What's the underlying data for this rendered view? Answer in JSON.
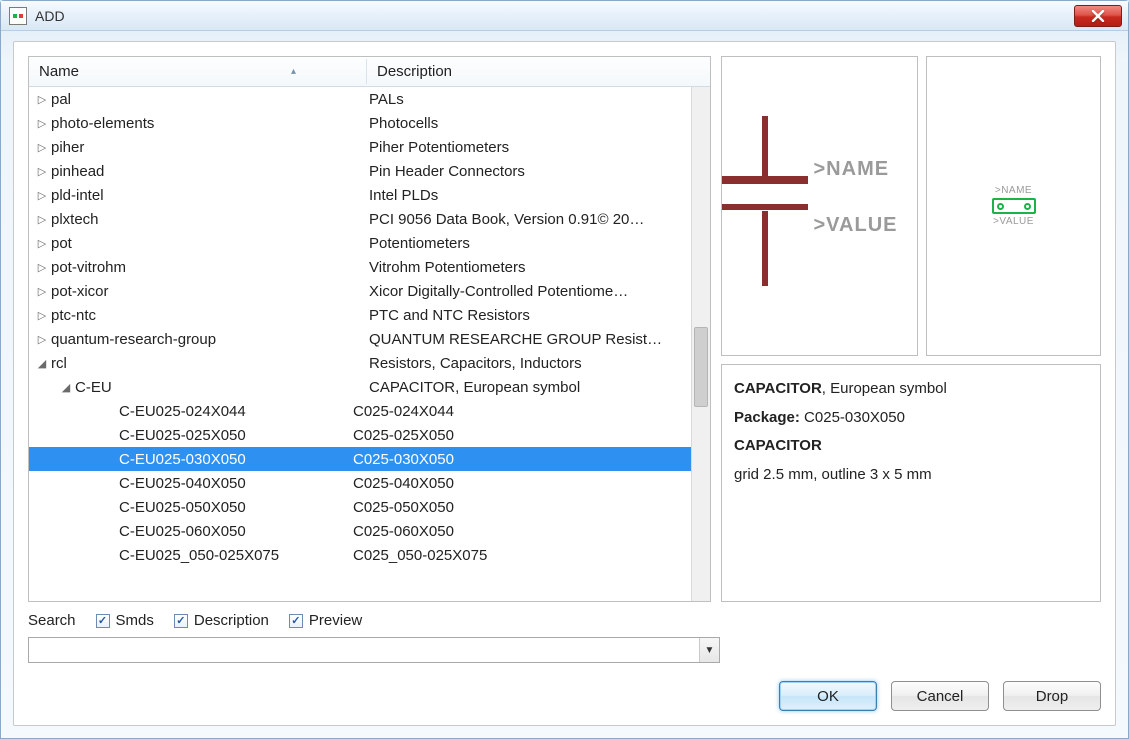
{
  "window": {
    "title": "ADD"
  },
  "columns": {
    "name": "Name",
    "description": "Description"
  },
  "rows": [
    {
      "name": "pal",
      "desc": "PALs",
      "depth": 0,
      "expand": "closed"
    },
    {
      "name": "photo-elements",
      "desc": "Photocells",
      "depth": 0,
      "expand": "closed"
    },
    {
      "name": "piher",
      "desc": "Piher Potentiometers",
      "depth": 0,
      "expand": "closed"
    },
    {
      "name": "pinhead",
      "desc": "Pin Header Connectors",
      "depth": 0,
      "expand": "closed"
    },
    {
      "name": "pld-intel",
      "desc": "Intel PLDs",
      "depth": 0,
      "expand": "closed"
    },
    {
      "name": "plxtech",
      "desc": "PCI 9056 Data Book, Version 0.91© 20…",
      "depth": 0,
      "expand": "closed"
    },
    {
      "name": "pot",
      "desc": "Potentiometers",
      "depth": 0,
      "expand": "closed"
    },
    {
      "name": "pot-vitrohm",
      "desc": "Vitrohm Potentiometers",
      "depth": 0,
      "expand": "closed"
    },
    {
      "name": "pot-xicor",
      "desc": "Xicor Digitally-Controlled Potentiome…",
      "depth": 0,
      "expand": "closed"
    },
    {
      "name": "ptc-ntc",
      "desc": "PTC and NTC Resistors",
      "depth": 0,
      "expand": "closed"
    },
    {
      "name": "quantum-research-group",
      "desc": "QUANTUM RESEARCHE GROUP Resist…",
      "depth": 0,
      "expand": "closed"
    },
    {
      "name": "rcl",
      "desc": "Resistors, Capacitors, Inductors",
      "depth": 0,
      "expand": "open"
    },
    {
      "name": "C-EU",
      "desc": "CAPACITOR, European symbol",
      "depth": 1,
      "expand": "open"
    },
    {
      "name": "C-EU025-024X044",
      "desc": "C025-024X044",
      "depth": 2
    },
    {
      "name": "C-EU025-025X050",
      "desc": "C025-025X050",
      "depth": 2
    },
    {
      "name": "C-EU025-030X050",
      "desc": "C025-030X050",
      "depth": 2,
      "selected": true
    },
    {
      "name": "C-EU025-040X050",
      "desc": "C025-040X050",
      "depth": 2
    },
    {
      "name": "C-EU025-050X050",
      "desc": "C025-050X050",
      "depth": 2
    },
    {
      "name": "C-EU025-060X050",
      "desc": "C025-060X050",
      "depth": 2
    },
    {
      "name": "C-EU025_050-025X075",
      "desc": "C025_050-025X075",
      "depth": 2
    }
  ],
  "preview": {
    "name_placeholder": ">NAME",
    "value_placeholder": ">VALUE",
    "board_name": ">NAME",
    "board_value": ">VALUE"
  },
  "info": {
    "type_bold": "CAPACITOR",
    "type_rest": ", European symbol",
    "package_label": "Package:",
    "package_value": "C025-030X050",
    "heading": "CAPACITOR",
    "detail": "grid 2.5 mm, outline 3 x 5 mm"
  },
  "search": {
    "label": "Search",
    "smds": "Smds",
    "description": "Description",
    "preview": "Preview",
    "value": ""
  },
  "buttons": {
    "ok": "OK",
    "cancel": "Cancel",
    "drop": "Drop"
  }
}
